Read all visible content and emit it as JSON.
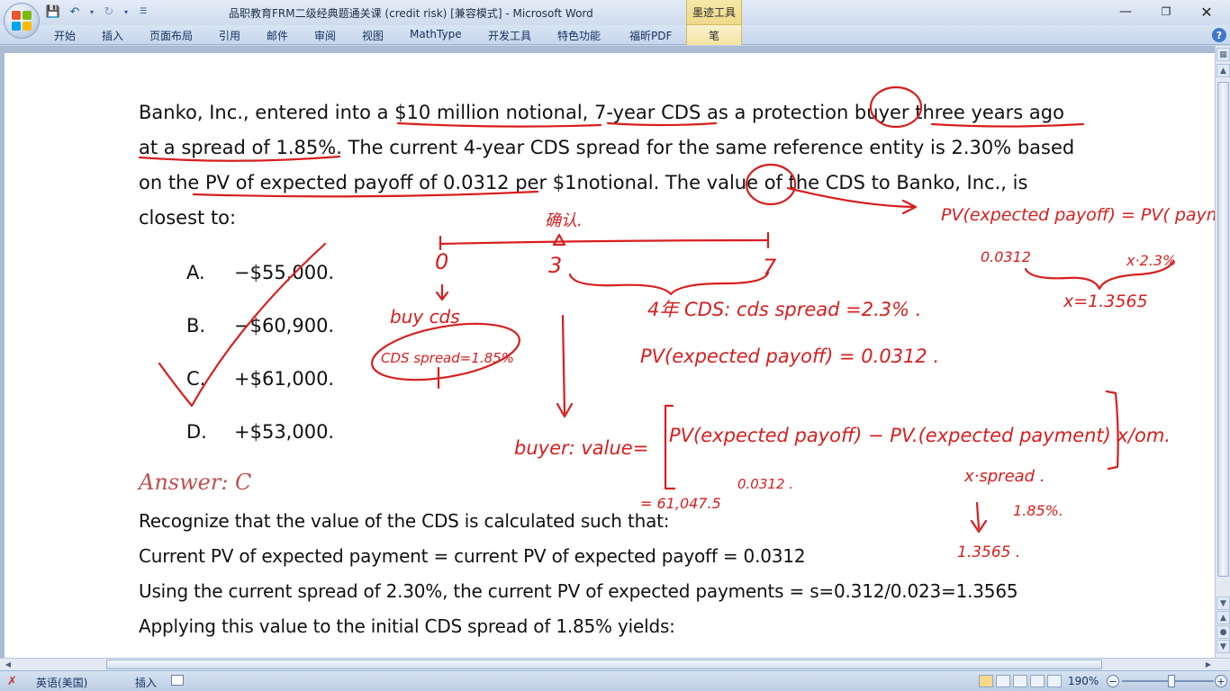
{
  "window": {
    "title": "品职教育FRM二级经典题通关课 (credit risk) [兼容模式] - Microsoft Word",
    "ink_tools": "墨迹工具"
  },
  "ribbon": {
    "tabs": [
      "开始",
      "插入",
      "页面布局",
      "引用",
      "邮件",
      "审阅",
      "视图",
      "MathType",
      "开发工具",
      "特色功能",
      "福昕PDF"
    ],
    "pen_tab": "笔"
  },
  "document": {
    "question_lines": [
      "Banko, Inc., entered into a $10 million notional, 7-year CDS as a protection buyer three years ago",
      "at a spread of 1.85%. The current 4-year CDS spread for the same reference entity is 2.30% based",
      "on the PV of expected payoff of 0.0312 per $1notional. The value of the CDS to Banko, Inc., is",
      "closest to:"
    ],
    "options": [
      {
        "letter": "A.",
        "text": "−$55,000."
      },
      {
        "letter": "B.",
        "text": "−$60,900."
      },
      {
        "letter": "C.",
        "text": "+$61,000."
      },
      {
        "letter": "D.",
        "text": "+$53,000."
      }
    ],
    "answer": "Answer: C",
    "solution": [
      "Recognize that the value of the CDS is calculated such that:",
      "Current PV of expected payment = current PV of expected payoff = 0.0312",
      "Using the current spread of 2.30%, the current PV of expected payments = s=0.312/0.023=1.3565",
      "Applying this value to the initial CDS spread of 1.85% yields:"
    ]
  },
  "status": {
    "language": "英语(美国)",
    "mode": "插入",
    "zoom": "190%"
  }
}
